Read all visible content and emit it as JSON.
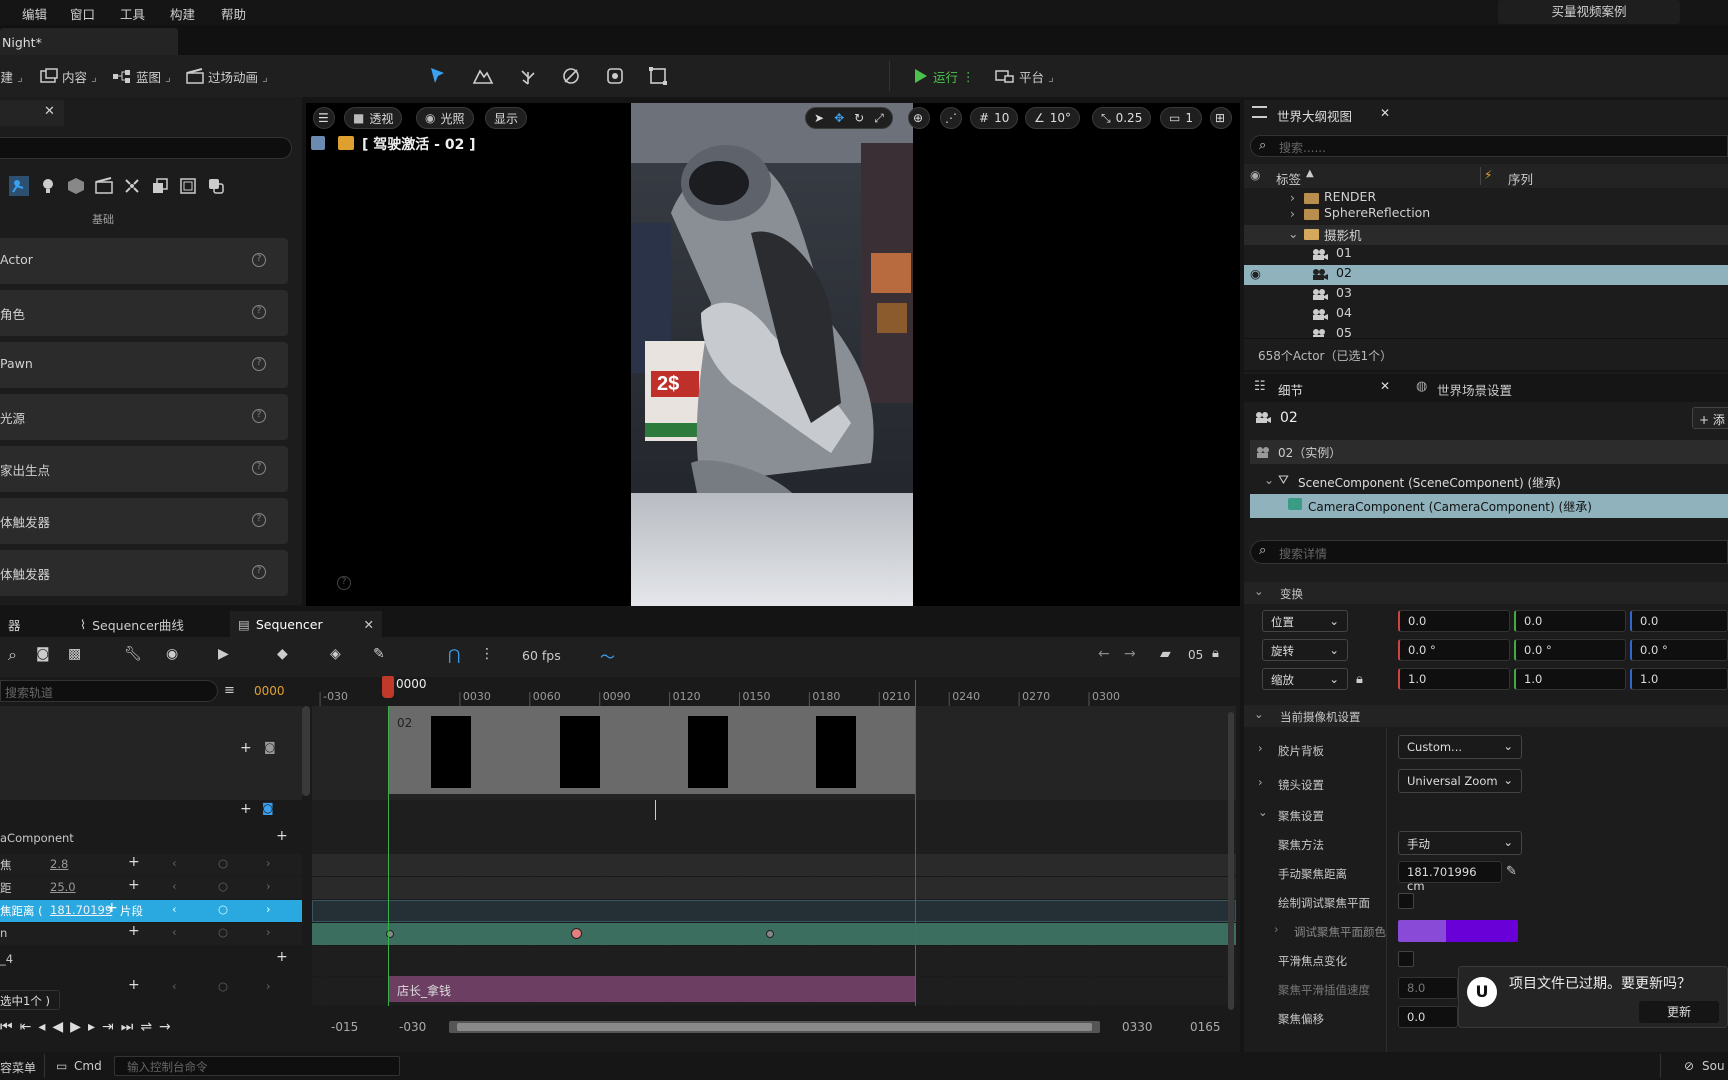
{
  "menu": {
    "items": [
      "编辑",
      "窗口",
      "工具",
      "构建",
      "帮助"
    ],
    "right_button": "买量视频案例"
  },
  "document_tab": "Night*",
  "toolbar": {
    "create": "创建",
    "content": "内容",
    "blueprint": "蓝图",
    "cinematics": "过场动画",
    "run": "运行",
    "platform": "平台"
  },
  "place_panel": {
    "basic_label": "基础",
    "items": [
      "Actor",
      "角色",
      "Pawn",
      "光源",
      "家出生点",
      "体触发器",
      "体触发器"
    ]
  },
  "viewport": {
    "perspective": "透视",
    "lit": "光照",
    "show": "显示",
    "grid_value": "10",
    "angle_value": "10°",
    "scale_value": "0.25",
    "camera_speed": "1",
    "camera_label": "[ 驾驶激活 - 02 ]"
  },
  "outliner": {
    "title": "世界大纲视图",
    "search_placeholder": "搜索......",
    "col_label": "标签",
    "col_sequence": "序列",
    "rows": [
      {
        "name": "RENDER",
        "type": "folder",
        "indent": 1
      },
      {
        "name": "SphereReflection",
        "type": "folder",
        "indent": 1
      },
      {
        "name": "摄影机",
        "type": "folder-open",
        "indent": 1
      },
      {
        "name": "01",
        "type": "camera",
        "indent": 2
      },
      {
        "name": "02",
        "type": "camera",
        "indent": 2,
        "selected": true
      },
      {
        "name": "03",
        "type": "camera",
        "indent": 2
      },
      {
        "name": "04",
        "type": "camera",
        "indent": 2
      },
      {
        "name": "05",
        "type": "camera",
        "indent": 2
      }
    ],
    "footer": "658个Actor（已选1个）"
  },
  "details": {
    "tab_details": "细节",
    "tab_world": "世界场景设置",
    "object_name": "02",
    "add_button": "+ 添",
    "instance": "02（实例）",
    "scene_component": "SceneComponent (SceneComponent) (继承)",
    "camera_component": "CameraComponent (CameraComponent) (继承)",
    "search_placeholder": "搜索详情",
    "transform_header": "变换",
    "transform": [
      {
        "label": "位置",
        "x": "0.0",
        "y": "0.0",
        "z": "0.0"
      },
      {
        "label": "旋转",
        "x": "0.0 °",
        "y": "0.0 °",
        "z": "0.0 °"
      },
      {
        "label": "缩放",
        "x": "1.0",
        "y": "1.0",
        "z": "1.0"
      }
    ],
    "camera_settings_header": "当前摄像机设置",
    "filmback_label": "胶片背板",
    "filmback_value": "Custom...",
    "lens_label": "镜头设置",
    "lens_value": "Universal Zoom",
    "focus_header": "聚焦设置",
    "focus_method_label": "聚焦方法",
    "focus_method_value": "手动",
    "manual_focus_label": "手动聚焦距离",
    "manual_focus_value": "181.701996 cm",
    "draw_debug_label": "绘制调试聚焦平面",
    "debug_color_label": "调试聚焦平面颜色",
    "smooth_label": "平滑焦点变化",
    "smooth_speed_label": "聚焦平滑插值速度",
    "smooth_speed_value": "8.0",
    "focus_offset_label": "聚焦偏移",
    "focus_offset_value": "0.0"
  },
  "sequencer": {
    "tab_left": "器",
    "tab_curve": "Sequencer曲线",
    "tab_main": "Sequencer",
    "fps": "60 fps",
    "search_placeholder": "搜索轨道",
    "current_frame": "0000",
    "playhead_label": "0000",
    "ruler_ticks": [
      "-030",
      "0030",
      "0060",
      "0090",
      "0120",
      "0150",
      "0180",
      "0210",
      "0240",
      "0270",
      "0300"
    ],
    "shot_name": "02",
    "camera_component_track": "aComponent",
    "track1_label": "焦",
    "track1_value": "2.8",
    "track2_label": "距",
    "track2_value": "25.0",
    "track3_label": "焦距离 ( ",
    "track3_value": "181.70199",
    "track3_suffix": "片段",
    "track4_label": "n",
    "track5_label": "_4",
    "track6_label": "选中1个 )",
    "audio_clip": "店长_拿钱",
    "range_start_out": "-015",
    "range_start_in": "-030",
    "range_end_in": "0330",
    "range_end_out": "0165",
    "sequence_count": "05",
    "keyframe_times": [
      0,
      80,
      163
    ]
  },
  "status": {
    "content_drawer": "容菜单",
    "cmd": "Cmd",
    "console_placeholder": "输入控制台命令",
    "source_control": "Sou"
  },
  "toast": {
    "message": "项目文件已过期。要更新吗？",
    "update_button": "更新"
  }
}
